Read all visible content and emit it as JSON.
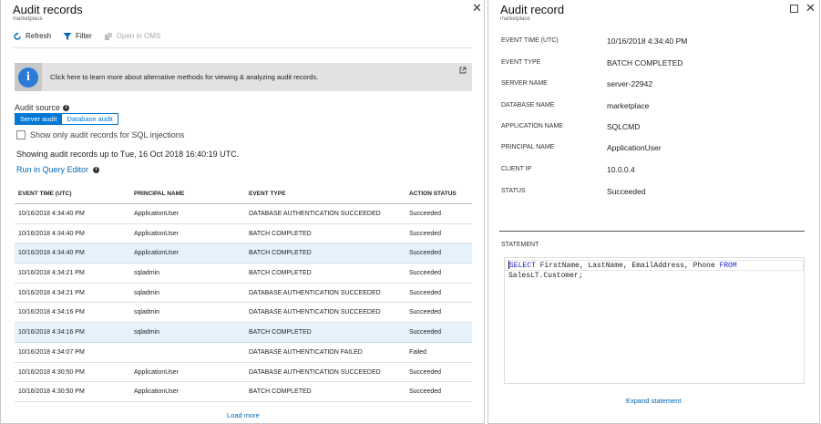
{
  "left_blade": {
    "title": "Audit records",
    "subtitle": "marketplace",
    "toolbar": {
      "refresh": "Refresh",
      "filter": "Filter",
      "open_oms": "Open in OMS"
    },
    "banner_text": "Click here to learn more about alternative methods for viewing & analyzing audit records.",
    "audit_source_label": "Audit source",
    "toggle": {
      "server": "Server audit",
      "database": "Database audit"
    },
    "checkbox_label": "Show only audit records for SQL injections",
    "showing_text": "Showing audit records up to Tue, 16 Oct 2018 16:40:19 UTC.",
    "run_query_label": "Run in Query Editor",
    "table": {
      "headers": [
        "EVENT TIME (UTC)",
        "PRINCIPAL NAME",
        "EVENT TYPE",
        "ACTION STATUS"
      ],
      "rows": [
        [
          "10/16/2018 4:34:40 PM",
          "ApplicationUser",
          "DATABASE AUTHENTICATION SUCCEEDED",
          "Succeeded"
        ],
        [
          "10/16/2018 4:34:40 PM",
          "ApplicationUser",
          "BATCH COMPLETED",
          "Succeeded"
        ],
        [
          "10/16/2018 4:34:40 PM",
          "ApplicationUser",
          "BATCH COMPLETED",
          "Succeeded"
        ],
        [
          "10/16/2018 4:34:21 PM",
          "sqladmin",
          "BATCH COMPLETED",
          "Succeeded"
        ],
        [
          "10/16/2018 4:34:21 PM",
          "sqladmin",
          "DATABASE AUTHENTICATION SUCCEEDED",
          "Succeeded"
        ],
        [
          "10/16/2018 4:34:16 PM",
          "sqladmin",
          "DATABASE AUTHENTICATION SUCCEEDED",
          "Succeeded"
        ],
        [
          "10/16/2018 4:34:16 PM",
          "sqladmin",
          "BATCH COMPLETED",
          "Succeeded"
        ],
        [
          "10/16/2018 4:34:07 PM",
          "",
          "DATABASE AUTHENTICATION FAILED",
          "Failed"
        ],
        [
          "10/16/2018 4:30:50 PM",
          "ApplicationUser",
          "DATABASE AUTHENTICATION SUCCEEDED",
          "Succeeded"
        ],
        [
          "10/16/2018 4:30:50 PM",
          "ApplicationUser",
          "BATCH COMPLETED",
          "Succeeded"
        ]
      ]
    },
    "load_more": "Load more"
  },
  "right_blade": {
    "title": "Audit record",
    "subtitle": "marketplace",
    "fields": [
      {
        "label": "EVENT TIME (UTC)",
        "value": "10/16/2018 4:34:40 PM"
      },
      {
        "label": "EVENT TYPE",
        "value": "BATCH COMPLETED"
      },
      {
        "label": "SERVER NAME",
        "value": "server-22942"
      },
      {
        "label": "DATABASE NAME",
        "value": "marketplace"
      },
      {
        "label": "APPLICATION NAME",
        "value": "SQLCMD"
      },
      {
        "label": "PRINCIPAL NAME",
        "value": "ApplicationUser"
      },
      {
        "label": "CLIENT IP",
        "value": "10.0.0.4"
      },
      {
        "label": "STATUS",
        "value": "Succeeded"
      }
    ],
    "statement_label": "STATEMENT",
    "statement": {
      "kw1": "SELECT",
      "line1_mid": " FirstName, LastName, EmailAddress, Phone ",
      "kw2": "FROM",
      "line2": "SalesLT.Customer;"
    },
    "expand_label": "Expand statement"
  },
  "colors": {
    "accent": "#0078d4",
    "link": "#0067b8",
    "selected_row": "#e6f2fb",
    "keyword": "#1e1ec8"
  }
}
